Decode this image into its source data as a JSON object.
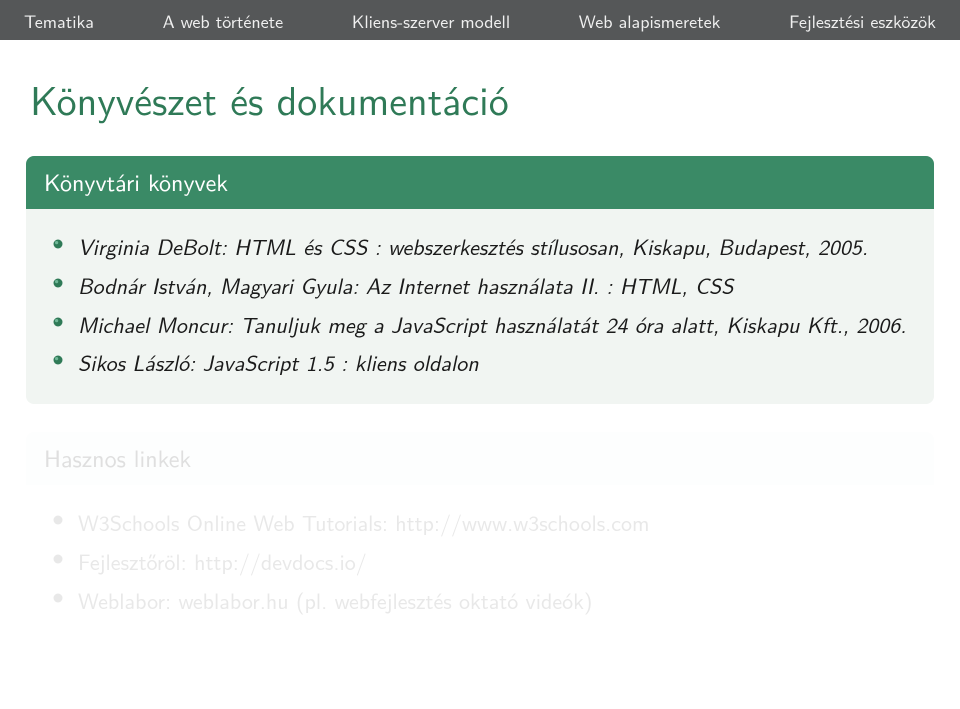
{
  "nav": {
    "items": [
      "Tematika",
      "A web története",
      "Kliens-szerver modell",
      "Web alapismeretek",
      "Fejlesztési eszközök"
    ]
  },
  "title": "Könyvészet és dokumentáció",
  "block1": {
    "header": "Könyvtári könyvek",
    "items": [
      "Virginia DeBolt: HTML és CSS : webszerkesztés stílusosan, Kiskapu, Budapest, 2005.",
      "Bodnár István, Magyari Gyula: Az Internet használata II. : HTML, CSS",
      "Michael Moncur: Tanuljuk meg a JavaScript használatát 24 óra alatt, Kiskapu Kft., 2006.",
      "Sikos László: JavaScript 1.5 : kliens oldalon"
    ]
  },
  "block2": {
    "header": "Hasznos linkek",
    "items": [
      "W3Schools Online Web Tutorials: http://www.w3schools.com",
      "Fejlesztőröl: http://devdocs.io/",
      "Weblabor: weblabor.hu (pl. webfejlesztés oktató videók)"
    ]
  }
}
